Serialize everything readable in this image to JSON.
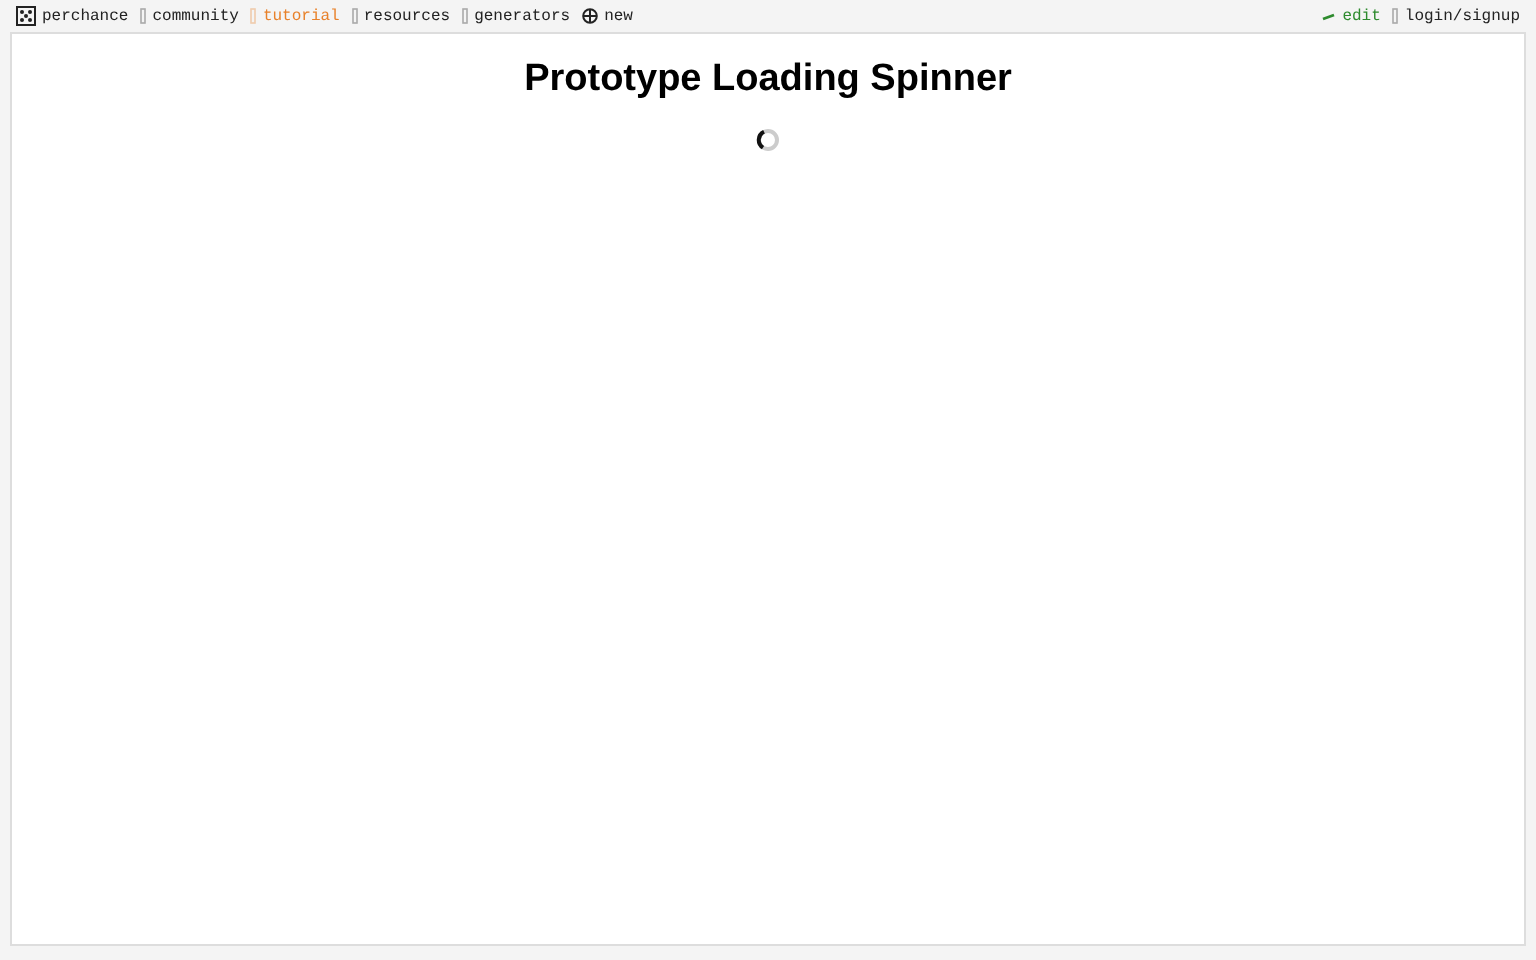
{
  "nav": {
    "left": [
      {
        "label": "perchance",
        "kind": "die",
        "color": "#222222"
      },
      {
        "label": "community",
        "kind": "glyph",
        "color": "#222222"
      },
      {
        "label": "tutorial",
        "kind": "glyph",
        "color": "#e8812a"
      },
      {
        "label": "resources",
        "kind": "glyph",
        "color": "#222222"
      },
      {
        "label": "generators",
        "kind": "glyph",
        "color": "#222222"
      },
      {
        "label": "new",
        "kind": "plus",
        "color": "#222222"
      }
    ],
    "right": [
      {
        "label": "edit",
        "kind": "pencil",
        "color": "#2e8b2e"
      },
      {
        "label": "login/signup",
        "kind": "glyph",
        "color": "#222222"
      }
    ]
  },
  "page": {
    "title": "Prototype Loading Spinner"
  }
}
